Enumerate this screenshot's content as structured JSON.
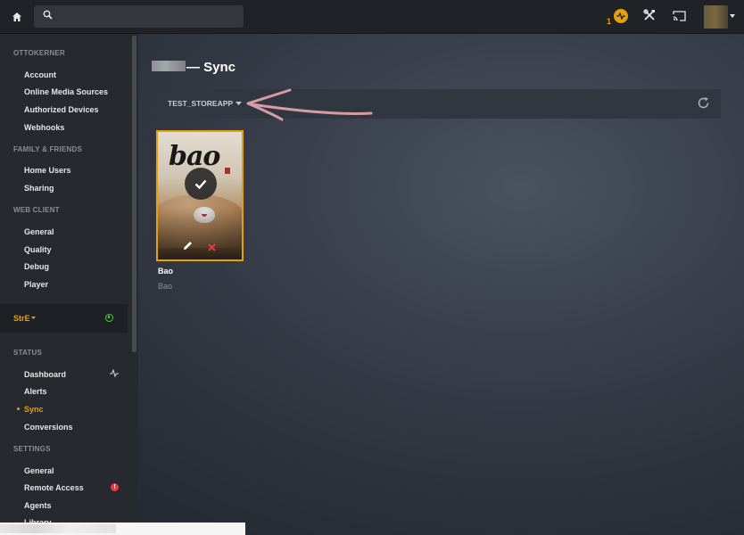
{
  "topbar": {
    "home_icon": "home-icon",
    "search_value": "",
    "activity_count": "1",
    "accent_color": "#e5a00d"
  },
  "sidebar": {
    "account_header": "OTTOKERNER",
    "account_items": [
      {
        "label": "Account"
      },
      {
        "label": "Online Media Sources"
      },
      {
        "label": "Authorized Devices"
      },
      {
        "label": "Webhooks"
      }
    ],
    "family_header": "FAMILY & FRIENDS",
    "family_items": [
      {
        "label": "Home Users"
      },
      {
        "label": "Sharing"
      }
    ],
    "webclient_header": "WEB CLIENT",
    "webclient_items": [
      {
        "label": "General"
      },
      {
        "label": "Quality"
      },
      {
        "label": "Debug"
      },
      {
        "label": "Player"
      }
    ],
    "server": {
      "name": "StrE",
      "status_color": "#5ac14a"
    },
    "status_header": "STATUS",
    "status_items": [
      {
        "label": "Dashboard"
      },
      {
        "label": "Alerts"
      },
      {
        "label": "Sync",
        "active": true
      },
      {
        "label": "Conversions"
      }
    ],
    "settings_header": "SETTINGS",
    "settings_items": [
      {
        "label": "General"
      },
      {
        "label": "Remote Access",
        "alert": "!"
      },
      {
        "label": "Agents"
      },
      {
        "label": "Library"
      }
    ]
  },
  "main": {
    "title": "— Sync",
    "device": "TEST_STOREAPP",
    "items": [
      {
        "poster_text": "bao",
        "title": "Bao",
        "subtitle": "Bao"
      }
    ]
  }
}
